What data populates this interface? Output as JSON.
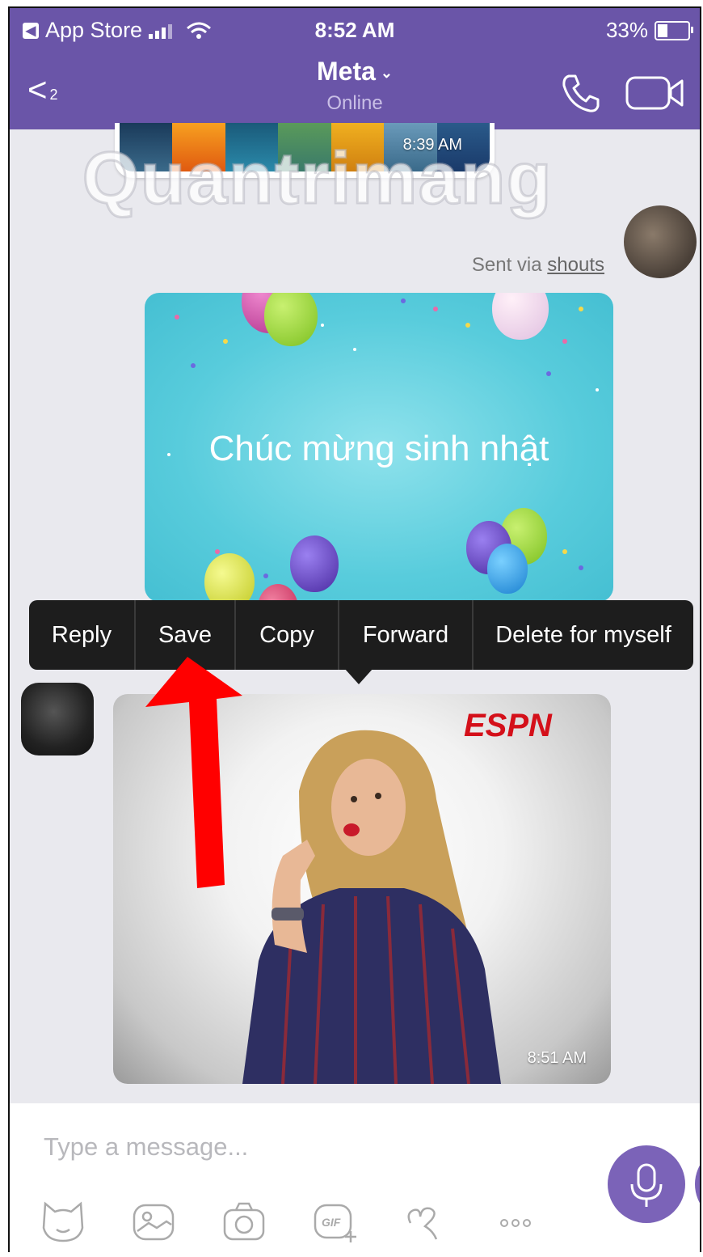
{
  "status_bar": {
    "back_app": "App Store",
    "time": "8:52 AM",
    "battery": "33%"
  },
  "header": {
    "back_count": "2",
    "title": "Meta",
    "subtitle": "Online"
  },
  "messages": {
    "thumb_time": "8:39 AM",
    "watermark": "Quantrimang",
    "sent_via_prefix": "Sent via ",
    "sent_via_link": "shouts",
    "card_text": "Chúc mừng sinh nhật",
    "gif_brand": "ESPN",
    "gif_time": "8:51 AM"
  },
  "context_menu": {
    "items": [
      "Reply",
      "Save",
      "Copy",
      "Forward",
      "Delete for myself"
    ]
  },
  "composer": {
    "placeholder": "Type a message..."
  },
  "colors": {
    "header_bg": "#6a55a8",
    "accent": "#7b63b8",
    "menu_bg": "#1d1d1d",
    "arrow": "#ff0000"
  },
  "icons": [
    "call-icon",
    "video-icon",
    "sticker-icon",
    "gallery-icon",
    "camera-icon",
    "gif-icon",
    "doodle-icon",
    "more-icon",
    "mic-icon"
  ]
}
